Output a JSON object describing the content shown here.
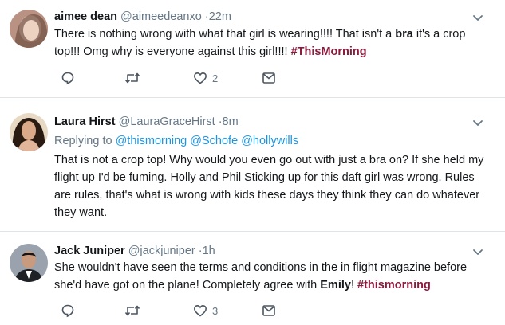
{
  "tweets": [
    {
      "name": "aimee dean",
      "handle": "@aimeedeanxo",
      "time": "·22m",
      "text_parts": [
        "There is nothing wrong with what that girl is wearing!!!! That isn't a ",
        "bra",
        " it's a crop top!!! Omg why is everyone against this girl!!!! ",
        "#ThisMorning"
      ],
      "replies": "",
      "retweets": "",
      "likes": "2",
      "avatar_icon": "user-avatar"
    },
    {
      "name": "Laura Hirst",
      "handle": "@LauraGraceHirst",
      "time": "·8m",
      "replying_label": "Replying to ",
      "replying_to": [
        "@thismorning",
        "@Schofe",
        "@hollywills"
      ],
      "text": "That is not a crop top! Why would you even go out with just a bra on? If she held my flight up I'd be fuming. Holly and Phil Sticking up for this daft girl was wrong. Rules are rules, that's what is wrong with kids these days they think they can do whatever they want.",
      "likes": "",
      "avatar_icon": "user-avatar"
    },
    {
      "name": "Jack Juniper",
      "handle": "@jackjuniper",
      "time": "·1h",
      "text_parts": [
        "She wouldn't have seen the terms and conditions in the in flight magazine before she'd have got on the plane! Completely agree with ",
        "Emily",
        "! ",
        "#thismorning"
      ],
      "likes": "3",
      "avatar_icon": "user-avatar"
    }
  ],
  "colors": {
    "hashtag": "#8b1a3c",
    "link": "#1b95e0",
    "muted": "#657786",
    "separator": "#dfe4e8"
  },
  "icons": [
    "reply-icon",
    "retweet-icon",
    "like-icon",
    "direct-message-icon",
    "chevron-down-icon"
  ]
}
